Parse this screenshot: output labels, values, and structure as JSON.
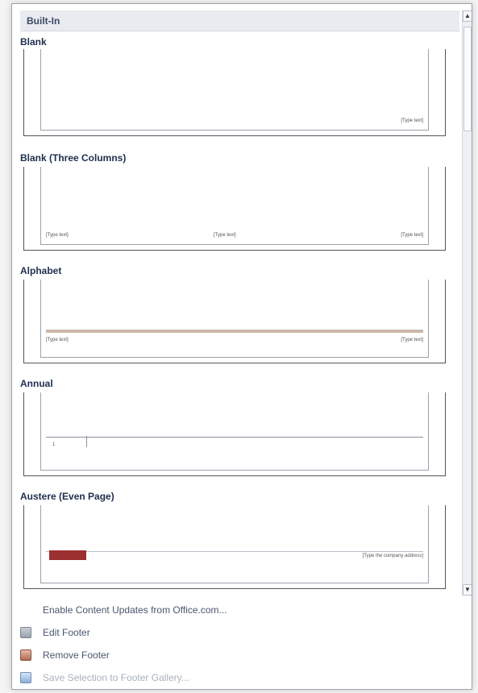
{
  "gallery": {
    "header": "Built-In",
    "items": [
      {
        "title": "Blank",
        "texts": [
          "[Type text]"
        ]
      },
      {
        "title": "Blank (Three Columns)",
        "texts": [
          "[Type text]",
          "[Type text]",
          "[Type text]"
        ]
      },
      {
        "title": "Alphabet",
        "texts": [
          "[Type text]",
          "[Type text]"
        ]
      },
      {
        "title": "Annual",
        "texts": [
          "1"
        ]
      },
      {
        "title": "Austere (Even Page)",
        "texts": [
          "[Type the company address]"
        ]
      }
    ]
  },
  "menu": {
    "items": [
      {
        "label": "Enable Content Updates from Office.com...",
        "enabled": true
      },
      {
        "label": "Edit Footer",
        "enabled": true
      },
      {
        "label": "Remove Footer",
        "enabled": true
      },
      {
        "label": "Save Selection to Footer Gallery...",
        "enabled": false
      }
    ]
  },
  "colors": {
    "alphabet_rule": "#c9b9ac",
    "austere_accent": "#9c2f2f"
  },
  "icons": {
    "scroll_up": "triangle-up",
    "scroll_down": "triangle-down"
  }
}
